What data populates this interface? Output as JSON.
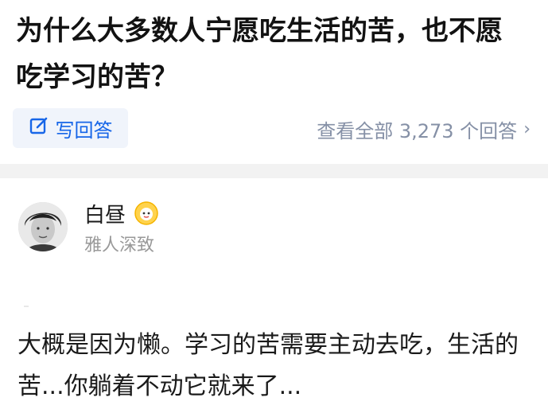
{
  "question": {
    "title": "为什么大多数人宁愿吃生活的苦，也不愿吃学习的苦？",
    "write_answer_label": "写回答",
    "view_all_label": "查看全部 3,273 个回答"
  },
  "answer": {
    "author_name": "白昼",
    "author_bio": "雅人深致",
    "content": "大概是因为懒。学习的苦需要主动去吃，生活的苦...你躺着不动它就来了..."
  },
  "colors": {
    "accent": "#1766e8",
    "muted": "#8590a6",
    "button_bg": "#f0f4fb",
    "separator": "#f2f2f2"
  },
  "icons": {
    "write": "edit-icon",
    "chevron": "chevron-right-icon",
    "badge": "badge-icon"
  }
}
